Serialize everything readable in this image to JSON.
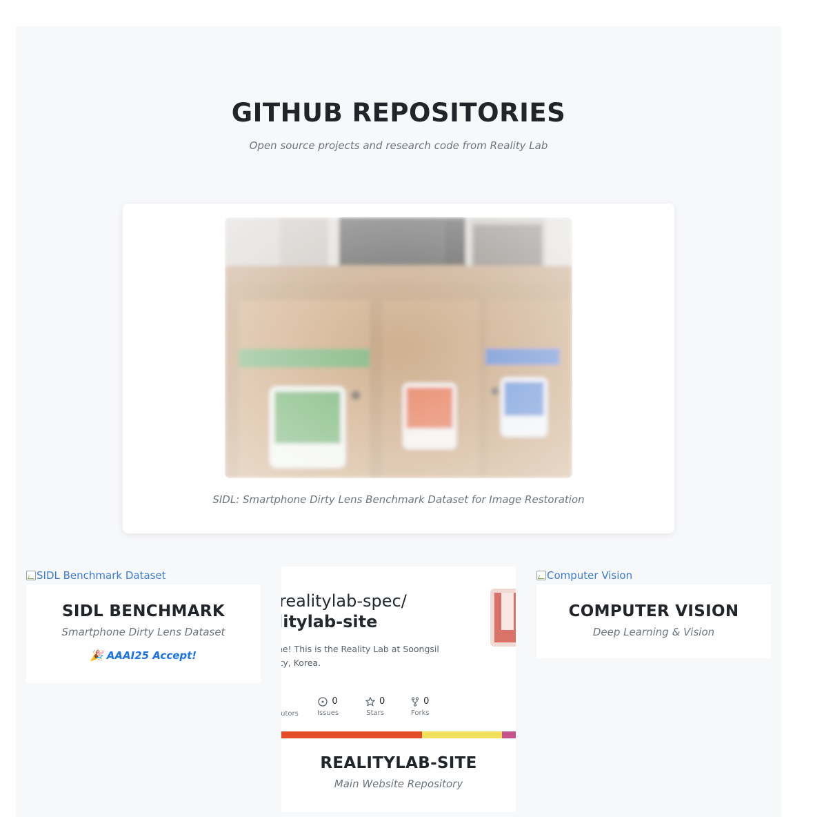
{
  "section": {
    "title": "GITHUB REPOSITORIES",
    "subtitle": "Open source projects and research code from Reality Lab"
  },
  "hero": {
    "image_alt": "SIDL dataset sample photo",
    "caption": "SIDL: Smartphone Dirty Lens Benchmark Dataset for Image Restoration"
  },
  "cards": [
    {
      "image_alt": "SIDL Benchmark Dataset",
      "title": "SIDL BENCHMARK",
      "subtitle": "Smartphone Dirty Lens Dataset",
      "badge_icon": "🎉",
      "badge": "AAAI25 Accept!"
    },
    {
      "title": "REALITYLAB-SITE",
      "subtitle": "Main Website Repository",
      "preview": {
        "owner": "realitylab-spec/",
        "repo": "litylab-site",
        "description": "ne! This is the Reality Lab at Soongsil ity, Korea.",
        "stats": [
          {
            "icon": "contributors-icon",
            "value": "",
            "label": "ibutors"
          },
          {
            "icon": "issues-icon",
            "value": "0",
            "label": "Issues"
          },
          {
            "icon": "star-icon",
            "value": "0",
            "label": "Stars"
          },
          {
            "icon": "fork-icon",
            "value": "0",
            "label": "Forks"
          }
        ],
        "languages": [
          {
            "color": "#e34c26",
            "share": 0.6
          },
          {
            "color": "#f1e05a",
            "share": 0.34
          },
          {
            "color": "#c6538c",
            "share": 0.06
          }
        ]
      }
    },
    {
      "image_alt": "Computer Vision",
      "title": "COMPUTER VISION",
      "subtitle": "Deep Learning & Vision"
    }
  ]
}
